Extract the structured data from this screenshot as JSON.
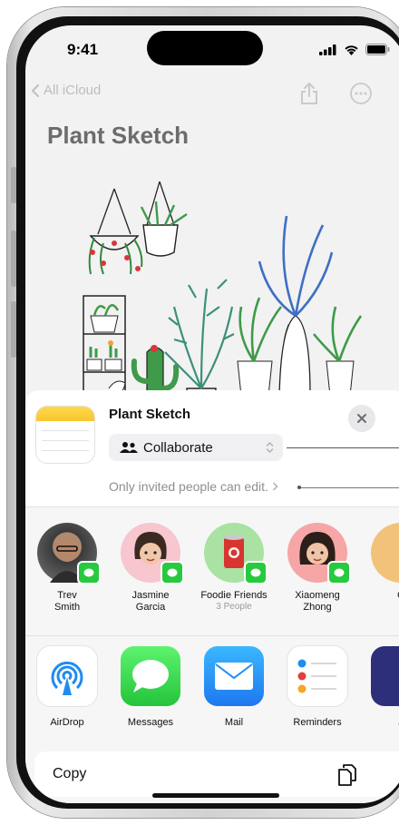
{
  "status_bar": {
    "time": "9:41"
  },
  "nav": {
    "back_label": "All iCloud"
  },
  "note": {
    "title": "Plant Sketch"
  },
  "share_sheet": {
    "title": "Plant Sketch",
    "collaborate_label": "Collaborate",
    "permission_text": "Only invited people can edit.",
    "people": [
      {
        "name_line1": "Trev",
        "name_line2": "Smith",
        "subtitle": ""
      },
      {
        "name_line1": "Jasmine",
        "name_line2": "Garcia",
        "subtitle": ""
      },
      {
        "name_line1": "Foodie Friends",
        "name_line2": "",
        "subtitle": "3 People"
      },
      {
        "name_line1": "Xiaomeng",
        "name_line2": "Zhong",
        "subtitle": ""
      },
      {
        "name_line1": "C",
        "name_line2": "",
        "subtitle": ""
      }
    ],
    "apps": [
      {
        "label": "AirDrop",
        "icon": "airdrop-icon"
      },
      {
        "label": "Messages",
        "icon": "messages-icon"
      },
      {
        "label": "Mail",
        "icon": "mail-icon"
      },
      {
        "label": "Reminders",
        "icon": "reminders-icon"
      },
      {
        "label": "J",
        "icon": "app-icon"
      }
    ],
    "copy_label": "Copy"
  },
  "colors": {
    "messages_green": "#27c93f",
    "mail_blue": "#1e8cf5",
    "airdrop_blue": "#1f8cf0",
    "notes_yellow": "#f8c62d"
  }
}
